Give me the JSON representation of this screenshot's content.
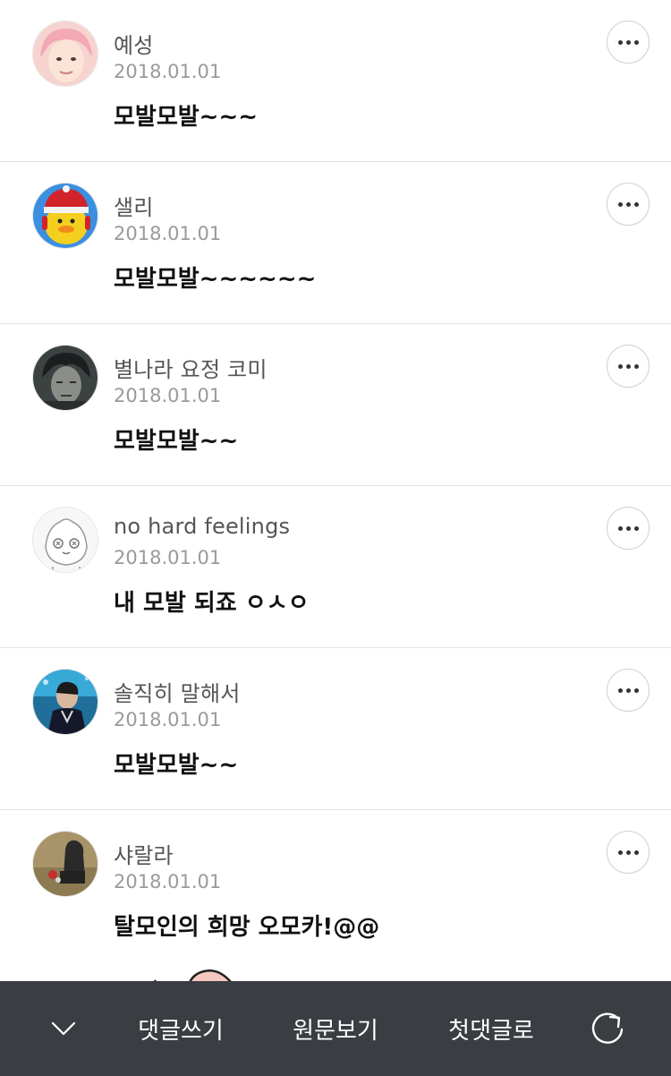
{
  "comments": [
    {
      "author": "예성",
      "date": "2018.01.01",
      "text": "모발모발~~~",
      "avatar": "pink-hair-person"
    },
    {
      "author": "샐리",
      "date": "2018.01.01",
      "text": "모발모발~~~~~~",
      "avatar": "sally-chick-character"
    },
    {
      "author": "별나라 요정 코미",
      "date": "2018.01.01",
      "text": "모발모발~~",
      "avatar": "dark-anime-person"
    },
    {
      "author": "no hard feelings",
      "date": "2018.01.01",
      "text": "내 모발 되죠 ㅇㅅㅇ",
      "avatar": "cartoon-sketch-face"
    },
    {
      "author": "솔직히 말해서",
      "date": "2018.01.01",
      "text": "모발모발~~",
      "avatar": "stage-performer"
    },
    {
      "author": "샤랄라",
      "date": "2018.01.01",
      "text": "탈모인의 희망 오모카!@@",
      "avatar": "person-sitting-outdoors"
    }
  ],
  "bottom_bar": {
    "write_comment": "댓글쓰기",
    "view_original": "원문보기",
    "first_comment": "첫댓글로"
  },
  "icons": {
    "more": "more-horizontal-icon",
    "collapse": "chevron-down-icon",
    "refresh": "refresh-icon"
  },
  "colors": {
    "bottom_bar_bg": "#3a3d42",
    "author_text": "#555555",
    "date_text": "#9a9a9a",
    "divider": "#e4e4e4"
  }
}
